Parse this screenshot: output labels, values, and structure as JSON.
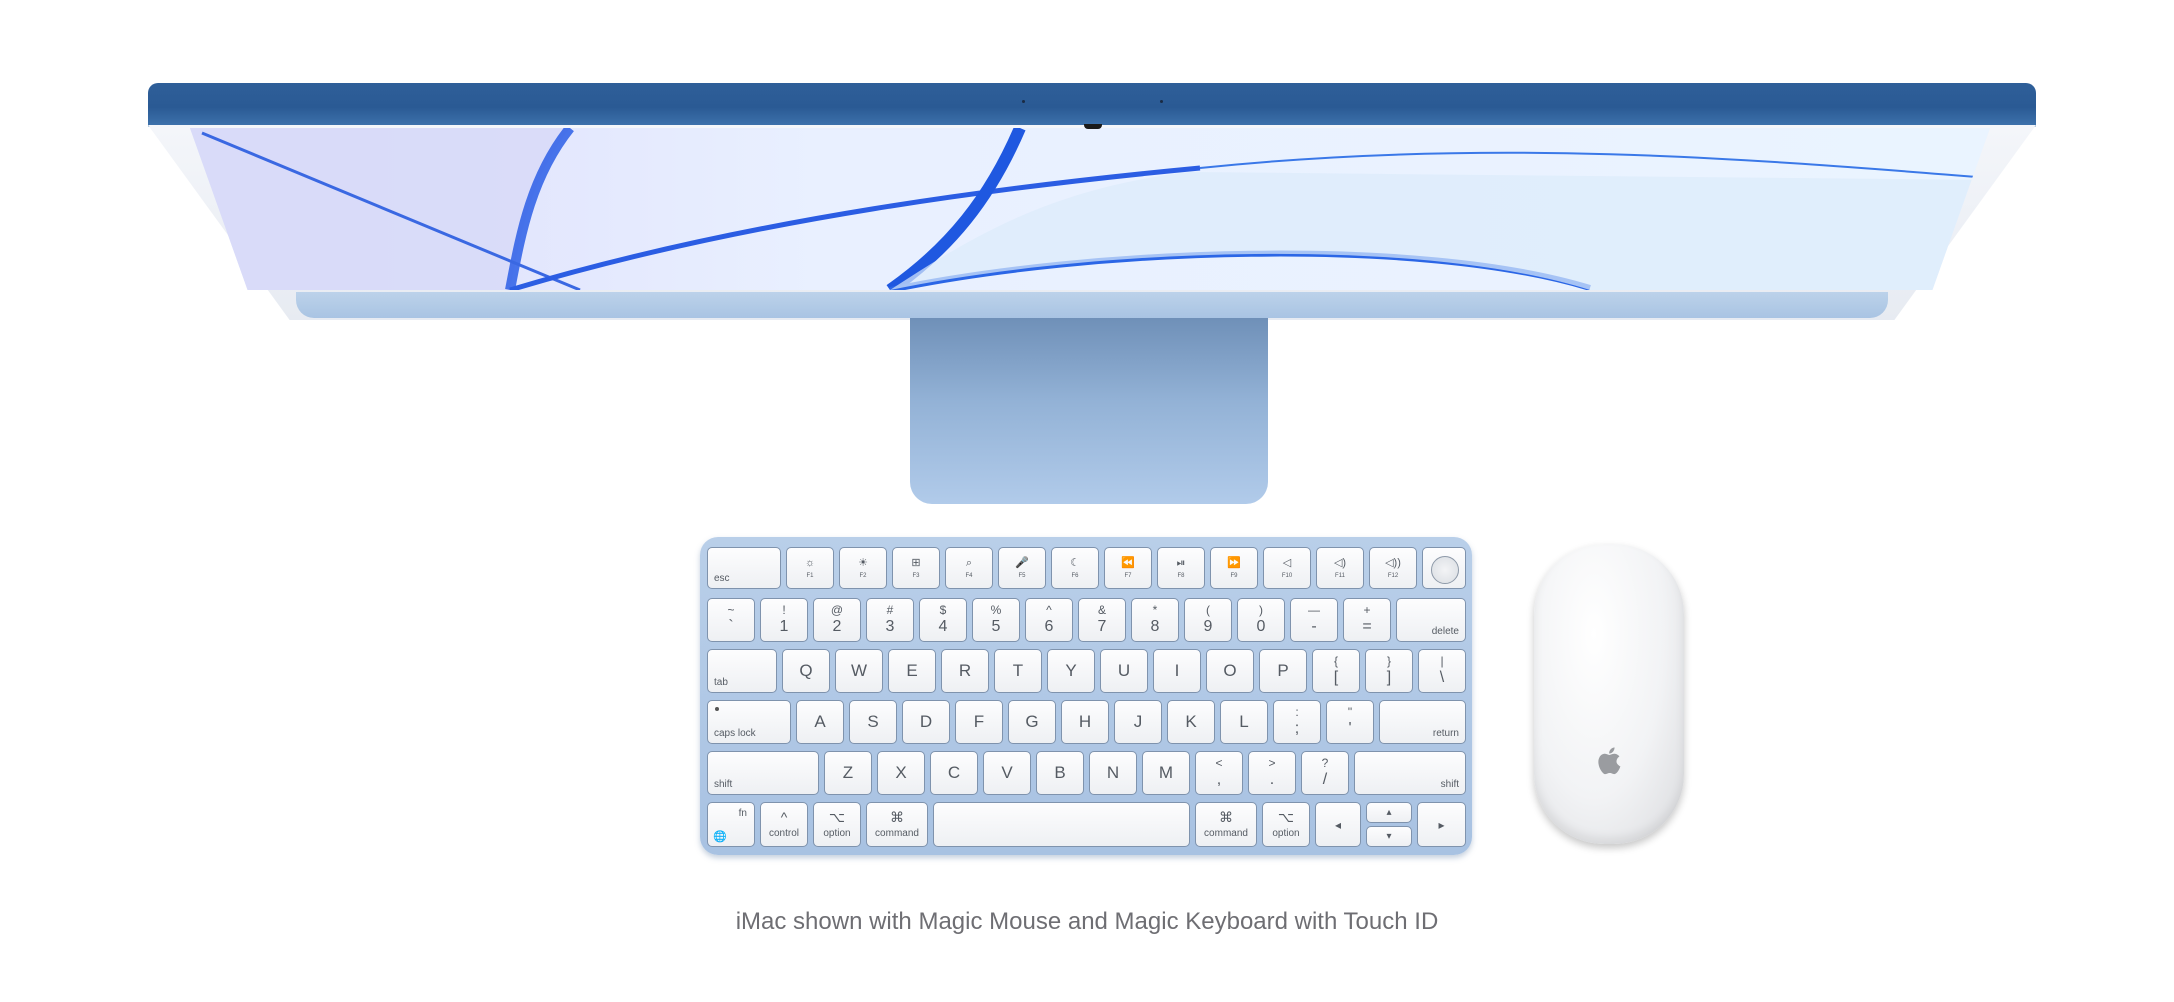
{
  "caption": "iMac shown with Magic Mouse and Magic Keyboard with Touch ID",
  "colors": {
    "imac_blue_edge": "#2f5f99",
    "imac_blue_light": "#a9c4e3",
    "keyboard_frame": "#b1c9e6",
    "wallpaper_blue": "#1d5be0",
    "caption_text": "#6e6e73"
  },
  "icons": {
    "touch_id": "touch-id-icon",
    "mouse_logo": "apple-logo-icon"
  },
  "keyboard": {
    "fn_row": [
      {
        "icon": "",
        "label": "esc"
      },
      {
        "icon": "☼",
        "label": "F1"
      },
      {
        "icon": "☀",
        "label": "F2"
      },
      {
        "icon": "⊞",
        "label": "F3"
      },
      {
        "icon": "⌕",
        "label": "F4"
      },
      {
        "icon": "🎤",
        "label": "F5"
      },
      {
        "icon": "☾",
        "label": "F6"
      },
      {
        "icon": "⏪",
        "label": "F7"
      },
      {
        "icon": "⏯",
        "label": "F8"
      },
      {
        "icon": "⏩",
        "label": "F9"
      },
      {
        "icon": "◁",
        "label": "F10"
      },
      {
        "icon": "◁)",
        "label": "F11"
      },
      {
        "icon": "◁))",
        "label": "F12"
      }
    ],
    "number_row": [
      {
        "top": "~",
        "bot": "`"
      },
      {
        "top": "!",
        "bot": "1"
      },
      {
        "top": "@",
        "bot": "2"
      },
      {
        "top": "#",
        "bot": "3"
      },
      {
        "top": "$",
        "bot": "4"
      },
      {
        "top": "%",
        "bot": "5"
      },
      {
        "top": "^",
        "bot": "6"
      },
      {
        "top": "&",
        "bot": "7"
      },
      {
        "top": "*",
        "bot": "8"
      },
      {
        "top": "(",
        "bot": "9"
      },
      {
        "top": ")",
        "bot": "0"
      },
      {
        "top": "—",
        "bot": "-"
      },
      {
        "top": "+",
        "bot": "="
      },
      {
        "top": "",
        "bot": "delete"
      }
    ],
    "qwerty_row": {
      "tab": "tab",
      "letters": [
        "Q",
        "W",
        "E",
        "R",
        "T",
        "Y",
        "U",
        "I",
        "O",
        "P"
      ],
      "symbols": [
        {
          "top": "{",
          "bot": "["
        },
        {
          "top": "}",
          "bot": "]"
        },
        {
          "top": "|",
          "bot": "\\"
        }
      ]
    },
    "home_row": {
      "caps": "caps lock",
      "letters": [
        "A",
        "S",
        "D",
        "F",
        "G",
        "H",
        "J",
        "K",
        "L"
      ],
      "symbols": [
        {
          "top": ":",
          "bot": ";"
        },
        {
          "top": "\"",
          "bot": "'"
        }
      ],
      "return": "return"
    },
    "shift_row": {
      "left_shift": "shift",
      "letters": [
        "Z",
        "X",
        "C",
        "V",
        "B",
        "N",
        "M"
      ],
      "symbols": [
        {
          "top": "<",
          "bot": ","
        },
        {
          "top": ">",
          "bot": "."
        },
        {
          "top": "?",
          "bot": "/"
        }
      ],
      "right_shift": "shift"
    },
    "bottom_row": {
      "fn": "fn",
      "globe": "🌐",
      "control_symbol": "^",
      "control": "control",
      "option_symbol": "⌥",
      "option": "option",
      "command_symbol": "⌘",
      "command": "command",
      "arrows": {
        "left": "◂",
        "up": "▴",
        "down": "▾",
        "right": "▸"
      }
    }
  }
}
